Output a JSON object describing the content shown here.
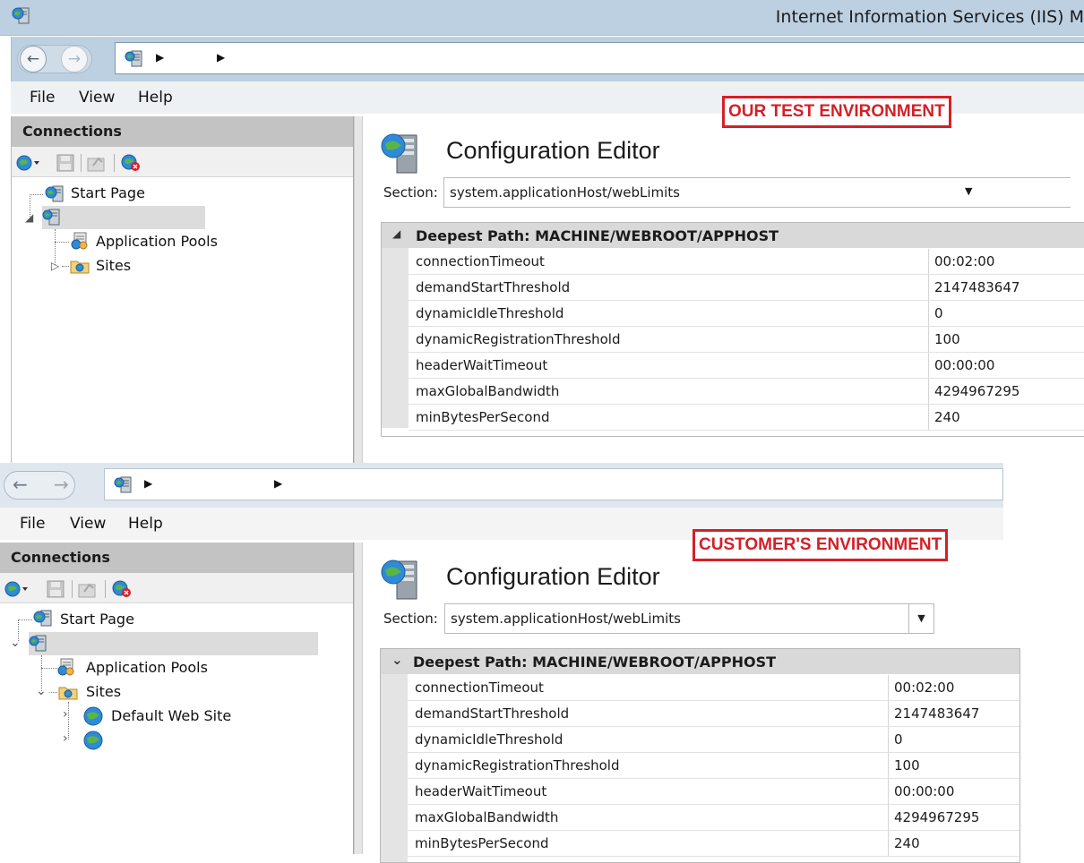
{
  "app_title": "Internet Information Services (IIS) M",
  "menu": {
    "file": "File",
    "view": "View",
    "help": "Help"
  },
  "connections_title": "Connections",
  "config_editor_title": "Configuration Editor",
  "section_label": "Section:",
  "section_value": "system.applicationHost/webLimits",
  "deepest_path": "Deepest Path: MACHINE/WEBROOT/APPHOST",
  "settings": [
    {
      "name": "connectionTimeout",
      "value": "00:02:00"
    },
    {
      "name": "demandStartThreshold",
      "value": "2147483647"
    },
    {
      "name": "dynamicIdleThreshold",
      "value": "0"
    },
    {
      "name": "dynamicRegistrationThreshold",
      "value": "100"
    },
    {
      "name": "headerWaitTimeout",
      "value": "00:00:00"
    },
    {
      "name": "maxGlobalBandwidth",
      "value": "4294967295"
    },
    {
      "name": "minBytesPerSecond",
      "value": "240"
    }
  ],
  "tree": {
    "start_page": "Start Page",
    "app_pools": "Application Pools",
    "sites": "Sites",
    "default_web_site": "Default Web Site"
  },
  "test_env": {
    "label": "OUR TEST ENVIRONMENT"
  },
  "customer_env": {
    "label": "CUSTOMER'S ENVIRONMENT"
  },
  "colors": {
    "annotation_red": "#d42027",
    "chrome_blue": "#bdd0e1"
  }
}
